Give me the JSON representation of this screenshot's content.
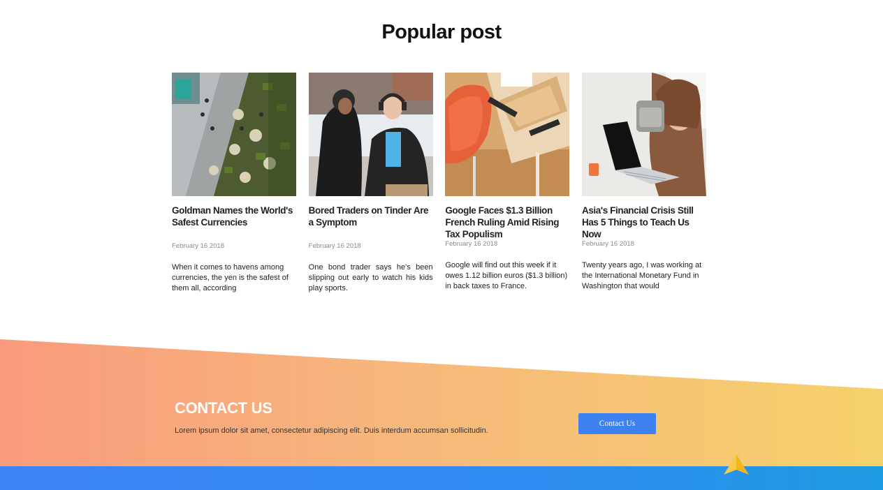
{
  "popular": {
    "title": "Popular post",
    "posts": [
      {
        "title": "Goldman Names the World's Safest Currencies",
        "date": "February 16 2018",
        "excerpt": "When it comes to havens among currencies, the yen is the safest of them all, according"
      },
      {
        "title": "Bored Traders on Tinder Are a Symptom",
        "date": "February 16 2018",
        "excerpt": "One bond trader says he's been slipping out early to watch his kids play sports."
      },
      {
        "title": "Google Faces $1.3 Billion French Ruling Amid Rising Tax Populism",
        "date": "February 16 2018",
        "excerpt": "Google will find out this week if it owes 1.12 billion euros ($1.3 billion) in back taxes to France."
      },
      {
        "title": "Asia's Financial Crisis Still Has 5 Things to Teach Us Now",
        "date": "February 16 2018",
        "excerpt": "Twenty years ago, I was working at the International Monetary Fund in Washington that would"
      }
    ]
  },
  "contact": {
    "title": "CONTACT US",
    "text": "Lorem ipsum dolor sit amet, consectetur adipiscing elit. Duis interdum accumsan sollicitudin.",
    "button_label": "Contact Us"
  },
  "icons": {
    "scroll_top": "arrow-up-icon"
  }
}
